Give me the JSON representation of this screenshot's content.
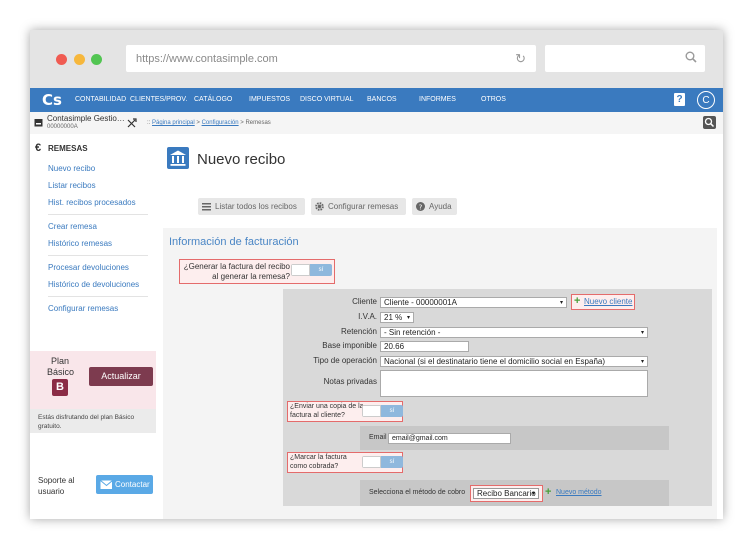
{
  "browser": {
    "url": "https://www.contasimple.com"
  },
  "nav": {
    "logo": "Cs",
    "items": [
      "CONTABILIDAD",
      "CLIENTES/PROV.",
      "CATÁLOGO",
      "IMPUESTOS",
      "DISCO VIRTUAL",
      "BANCOS",
      "INFORMES",
      "OTROS"
    ],
    "help": "?",
    "avatar": "C"
  },
  "subheader": {
    "company": "Contasimple Gestio…",
    "company_code": "00000000A",
    "breadcrumb_home": "Página principal",
    "breadcrumb_config": "Configuración",
    "breadcrumb_current": "Remesas",
    "sep": ">"
  },
  "sidebar": {
    "title": "REMESAS",
    "links": [
      "Nuevo recibo",
      "Listar recibos",
      "Hist. recibos procesados",
      "Crear remesa",
      "Histórico remesas",
      "Procesar devoluciones",
      "Histórico de devoluciones",
      "Configurar remesas"
    ],
    "plan_label": "Plan Básico",
    "plan_badge": "B",
    "upgrade": "Actualizar",
    "plan_note": "Estás disfrutando del plan Básico gratuito.",
    "support": "Soporte al usuario",
    "contact": "Contactar"
  },
  "main": {
    "title": "Nuevo recibo",
    "toolbar": {
      "list": "Listar todos los recibos",
      "config": "Configurar remesas",
      "help": "Ayuda"
    },
    "section_title": "Información de facturación",
    "q_generate": "¿Generar la factura del recibo al generar la remesa?",
    "toggle_on": "sí",
    "cliente_label": "Cliente",
    "cliente_value": "Cliente - 00000001A",
    "new_client": "Nuevo cliente",
    "iva_label": "I.V.A.",
    "iva_value": "21 %",
    "ret_label": "Retención",
    "ret_value": "- Sin retención -",
    "base_label": "Base imponible",
    "base_value": "20.66",
    "tipo_label": "Tipo de operación",
    "tipo_value": "Nacional (si el destinatario tiene el domicilio social en España)",
    "notas_label": "Notas privadas",
    "q_send": "¿Enviar una copia de la factura al cliente?",
    "email_label": "Email",
    "email_value": "email@gmail.com",
    "q_paid": "¿Marcar la factura como cobrada?",
    "method_label": "Selecciona el método de cobro",
    "method_value": "Recibo Bancario",
    "new_method": "Nuevo método"
  },
  "colors": {
    "nav": "#3a7abf",
    "plan": "#8b2c46",
    "highlight": "#e46b6b",
    "link": "#3a7abf"
  }
}
